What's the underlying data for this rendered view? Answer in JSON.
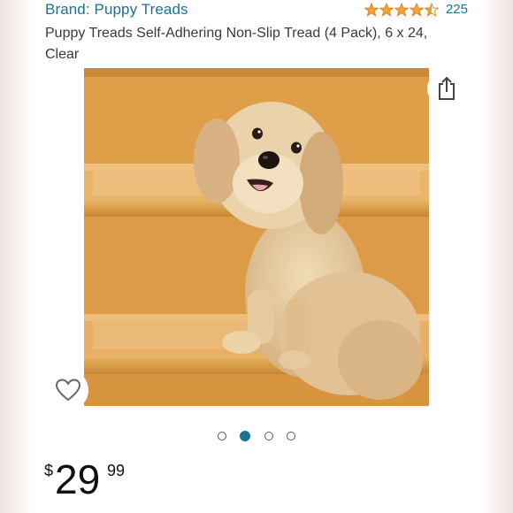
{
  "product": {
    "brand": "Brand: Puppy Treads",
    "title": "Puppy Treads Self-Adhering Non-Slip Tread (4 Pack), 6 x 24, Clear",
    "rating": 4.5,
    "rating_count": "225",
    "price": {
      "currency_symbol": "$",
      "whole": "29",
      "fraction": "99"
    }
  },
  "gallery": {
    "image_count": 4,
    "active_index": 1
  },
  "icons": {
    "star": "star-icon",
    "share": "share-icon",
    "favorite": "heart-icon"
  },
  "colors": {
    "link": "#1a7490",
    "star": "#f0a23b",
    "dot_active": "#1a7490",
    "text": "#3a3a3a"
  }
}
